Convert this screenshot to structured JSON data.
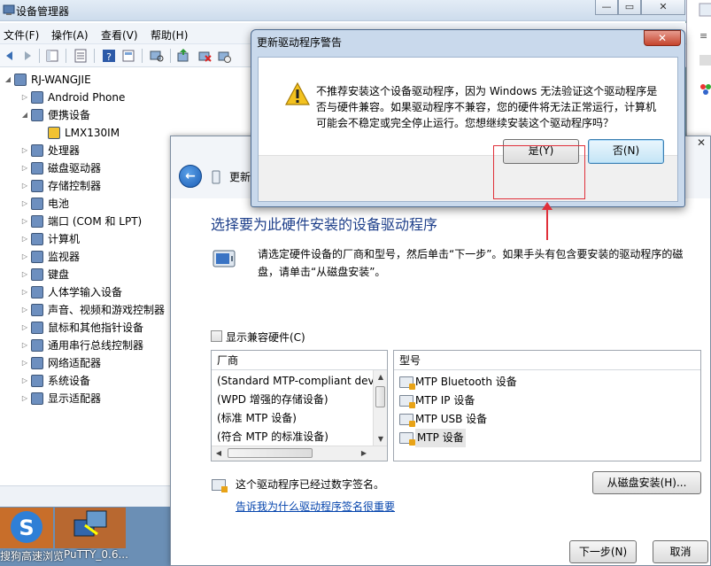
{
  "device_manager": {
    "title": "设备管理器",
    "menus": [
      "文件(F)",
      "操作(A)",
      "查看(V)",
      "帮助(H)"
    ],
    "tree": [
      {
        "label": "RJ-WANGJIE",
        "expanded": true,
        "level": 0,
        "icon": "computer-icon"
      },
      {
        "label": "Android Phone",
        "expanded": false,
        "level": 1,
        "icon": "phone-icon"
      },
      {
        "label": "便携设备",
        "expanded": true,
        "level": 1,
        "icon": "portable-device-icon"
      },
      {
        "label": "LMX130IM",
        "level": 2,
        "icon": "warning-device-icon"
      },
      {
        "label": "处理器",
        "expanded": false,
        "level": 1,
        "icon": "processor-icon"
      },
      {
        "label": "磁盘驱动器",
        "expanded": false,
        "level": 1,
        "icon": "disk-icon"
      },
      {
        "label": "存储控制器",
        "expanded": false,
        "level": 1,
        "icon": "storage-controller-icon"
      },
      {
        "label": "电池",
        "expanded": false,
        "level": 1,
        "icon": "battery-icon"
      },
      {
        "label": "端口 (COM 和 LPT)",
        "expanded": false,
        "level": 1,
        "icon": "port-icon"
      },
      {
        "label": "计算机",
        "expanded": false,
        "level": 1,
        "icon": "computer-icon"
      },
      {
        "label": "监视器",
        "expanded": false,
        "level": 1,
        "icon": "monitor-icon"
      },
      {
        "label": "键盘",
        "expanded": false,
        "level": 1,
        "icon": "keyboard-icon"
      },
      {
        "label": "人体学输入设备",
        "expanded": false,
        "level": 1,
        "icon": "hid-icon"
      },
      {
        "label": "声音、视频和游戏控制器",
        "expanded": false,
        "level": 1,
        "icon": "sound-icon"
      },
      {
        "label": "鼠标和其他指针设备",
        "expanded": false,
        "level": 1,
        "icon": "mouse-icon"
      },
      {
        "label": "通用串行总线控制器",
        "expanded": false,
        "level": 1,
        "icon": "usb-icon"
      },
      {
        "label": "网络适配器",
        "expanded": false,
        "level": 1,
        "icon": "network-icon"
      },
      {
        "label": "系统设备",
        "expanded": false,
        "level": 1,
        "icon": "system-icon"
      },
      {
        "label": "显示适配器",
        "expanded": false,
        "level": 1,
        "icon": "display-adapter-icon"
      }
    ]
  },
  "desktop": {
    "icons": [
      {
        "label": "搜狗高速浏览",
        "icon": "browser-icon"
      },
      {
        "label": "PuTTY_0.6...",
        "icon": "putty-icon"
      }
    ]
  },
  "wizard": {
    "title": "更新",
    "heading": "选择要为此硬件安装的设备驱动程序",
    "description": "请选定硬件设备的厂商和型号，然后单击“下一步”。如果手头有包含要安装的驱动程序的磁盘，请单击“从磁盘安装”。",
    "show_compatible_label": "显示兼容硬件(C)",
    "manufacturer_header": "厂商",
    "manufacturers": [
      "(Standard MTP-compliant dev",
      "(WPD 增强的存储设备)",
      "(标准 MTP 设备)",
      "(符合 MTP 的标准设备)"
    ],
    "model_header": "型号",
    "models": [
      "MTP Bluetooth 设备",
      "MTP IP 设备",
      "MTP USB 设备",
      "MTP 设备"
    ],
    "selected_model_index": 3,
    "signed_text": "这个驱动程序已经过数字签名。",
    "signed_link": "告诉我为什么驱动程序签名很重要",
    "have_disk_label": "从磁盘安装(H)...",
    "next_label": "下一步(N)",
    "cancel_label": "取消",
    "close_label": "✕"
  },
  "warning_dialog": {
    "title": "更新驱动程序警告",
    "message": "不推荐安装这个设备驱动程序，因为 Windows 无法验证这个驱动程序是否与硬件兼容。如果驱动程序不兼容，您的硬件将无法正常运行，计算机可能会不稳定或完全停止运行。您想继续安装这个驱动程序吗？",
    "yes_label": "是(Y)",
    "no_label": "否(N)",
    "close_label": "✕"
  },
  "colors": {
    "highlight": "#e0303a",
    "heading": "#1e3f8a",
    "link": "#0645ad"
  }
}
